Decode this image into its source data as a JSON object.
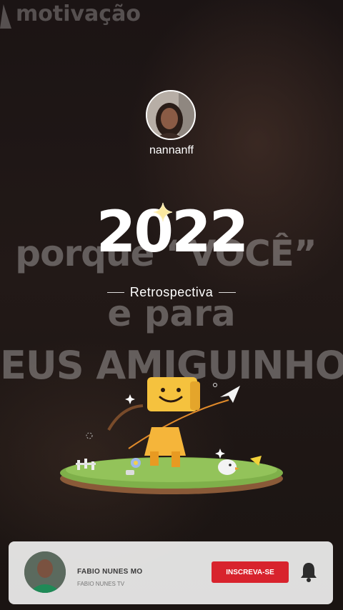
{
  "background": {
    "watermark": "motivação",
    "lines": [
      "porque “VOCÊ”",
      "e para",
      "EUS AMIGUINHO"
    ]
  },
  "profile": {
    "username": "nannanff"
  },
  "recap": {
    "year": "2022",
    "subtitle": "Retrospectiva"
  },
  "channel_card": {
    "name": "FABIO NUNES MO",
    "subtitle": "FABIO NUNES TV",
    "subscribe_label": "INSCREVA-SE"
  },
  "icons": [
    "sparkle-icon",
    "paper-plane-icon",
    "bell-icon",
    "mascot-icon"
  ],
  "colors": {
    "accent_red": "#d8232d",
    "mascot_yellow": "#f5b53a",
    "grass_green": "#7fb04a"
  }
}
